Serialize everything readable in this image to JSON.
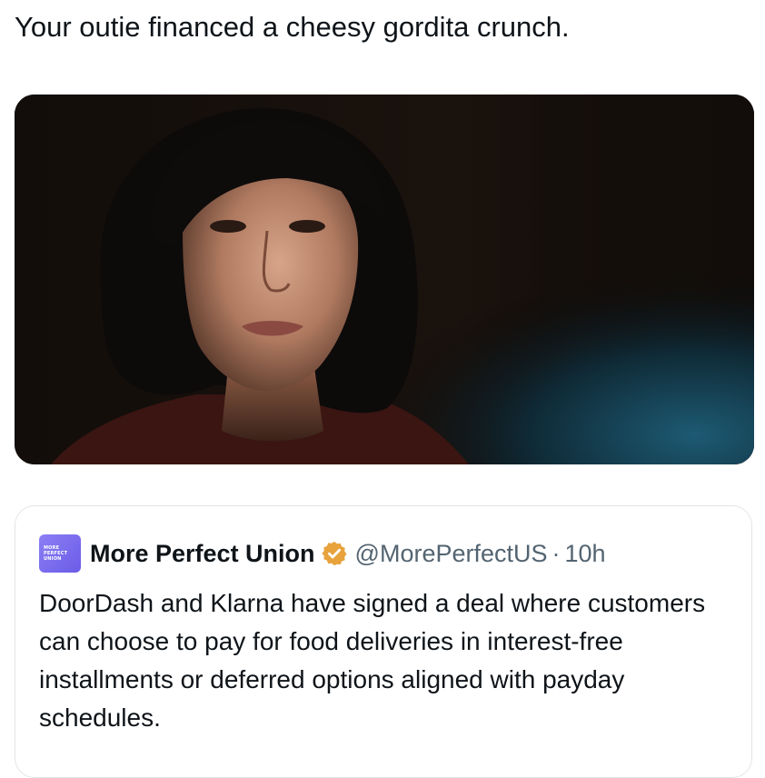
{
  "tweet": {
    "text": "Your outie financed a cheesy gordita crunch."
  },
  "media": {
    "icon": "photo-still"
  },
  "quote": {
    "avatar_lines": [
      "MORE",
      "PERFECT",
      "UNION"
    ],
    "display_name": "More Perfect Union",
    "verified_icon": "gold-verified-badge",
    "handle": "@MorePerfectUS",
    "separator": "·",
    "time": "10h",
    "text": "DoorDash and Klarna have signed a deal where customers can choose to pay for food deliveries in interest-free installments or deferred options aligned with payday schedules."
  },
  "colors": {
    "verified_gold": "#e8a33d",
    "avatar_purple": "#7a6cf0",
    "secondary_text": "#536471"
  }
}
